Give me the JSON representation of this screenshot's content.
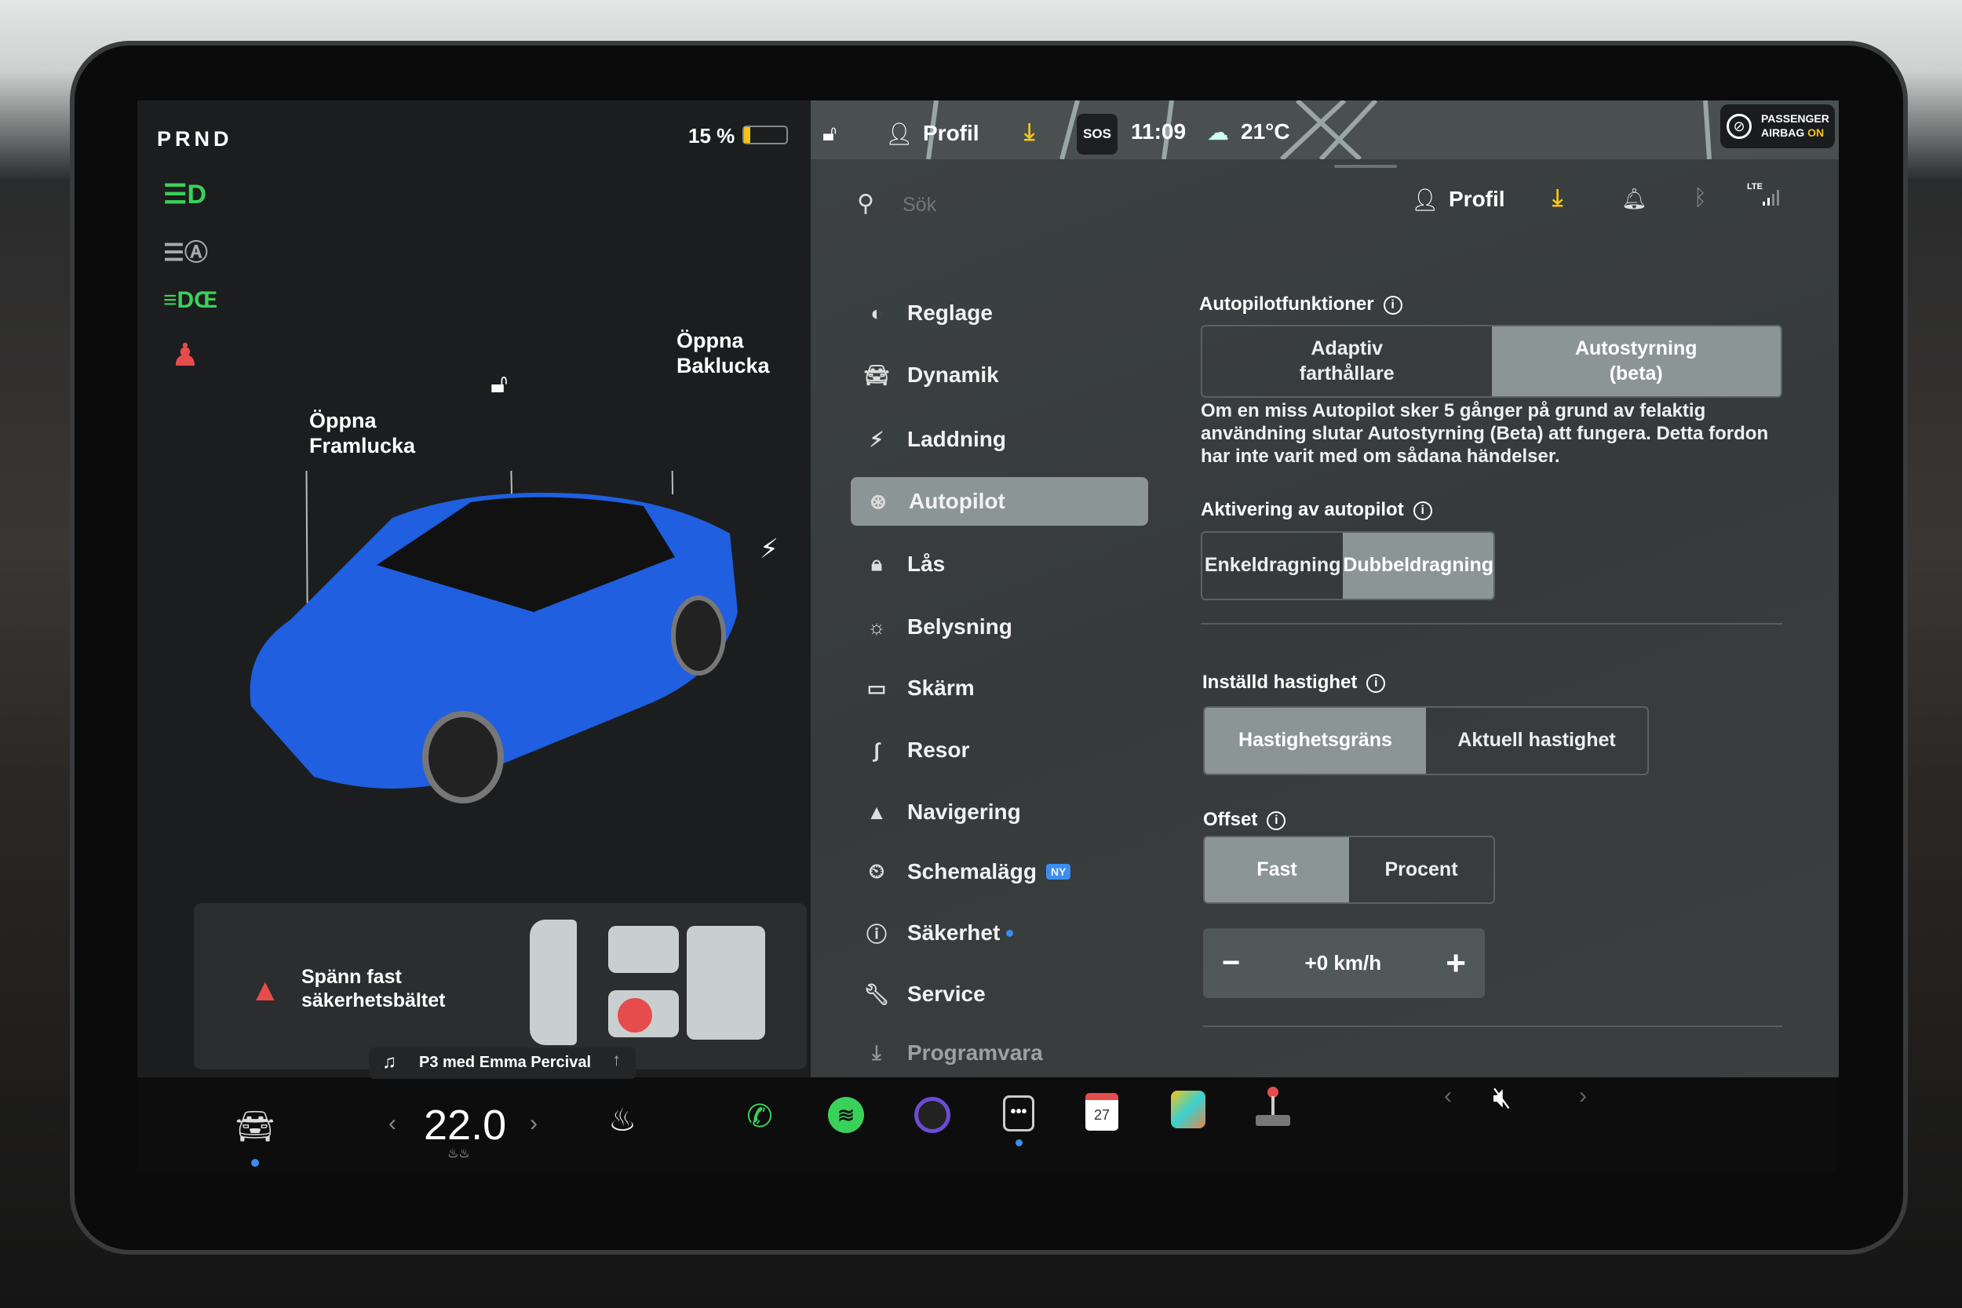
{
  "status_left": {
    "gear": "PRND",
    "battery": "15 %",
    "battery_level_percent": 15
  },
  "left_icons": [
    "low-beam-icon",
    "auto-high-beam-icon",
    "parking-lights-icon",
    "seatbelt-warning-icon"
  ],
  "car": {
    "frunk_label": "Öppna\nFramlucka",
    "trunk_label": "Öppna\nBaklucka",
    "color": "#1f5fe0"
  },
  "alert": {
    "text": "Spänn fast\nsäkerhetsbältet",
    "color": "#e74c4c"
  },
  "media": {
    "now_playing": "P3 med Emma Percival"
  },
  "top_bar": {
    "profile": "Profil",
    "sos": "SOS",
    "time": "11:09",
    "temp": "21°C",
    "airbag_line1": "PASSENGER",
    "airbag_line2": "AIRBAG",
    "airbag_state": "ON",
    "accent": "#f5c518"
  },
  "search": {
    "placeholder": "Sök",
    "profile": "Profil",
    "lte": "LTE"
  },
  "menu": [
    {
      "label": "Reglage",
      "icon": "toggle-icon"
    },
    {
      "label": "Dynamik",
      "icon": "car-icon"
    },
    {
      "label": "Laddning",
      "icon": "bolt-icon"
    },
    {
      "label": "Autopilot",
      "icon": "steering-wheel-icon",
      "active": true
    },
    {
      "label": "Lås",
      "icon": "lock-icon"
    },
    {
      "label": "Belysning",
      "icon": "sun-icon"
    },
    {
      "label": "Skärm",
      "icon": "display-icon"
    },
    {
      "label": "Resor",
      "icon": "trips-icon"
    },
    {
      "label": "Navigering",
      "icon": "navigation-icon"
    },
    {
      "label": "Schemalägg",
      "icon": "clock-icon",
      "badge": "NY"
    },
    {
      "label": "Säkerhet",
      "icon": "alert-circle-icon"
    },
    {
      "label": "Service",
      "icon": "wrench-icon"
    },
    {
      "label": "Programvara",
      "icon": "download-icon"
    }
  ],
  "autopilot": {
    "features_title": "Autopilotfunktioner",
    "features": [
      "Adaptiv\nfarthållare",
      "Autostyrning\n(beta)"
    ],
    "features_selected": 1,
    "notice": "Om en miss Autopilot sker 5 gånger på grund av felaktig användning slutar Autostyrning (Beta) att fungera. Detta fordon har inte varit med om sådana händelser.",
    "activation_title": "Aktivering av autopilot",
    "activation": [
      "Enkeldragning",
      "Dubbeldragning"
    ],
    "activation_selected": 1,
    "speed_title": "Inställd hastighet",
    "speed": [
      "Hastighetsgräns",
      "Aktuell hastighet"
    ],
    "speed_selected": 0,
    "offset_title": "Offset",
    "offset": [
      "Fast",
      "Procent"
    ],
    "offset_selected": 0,
    "offset_value": "+0 km/h",
    "minus": "−",
    "plus": "+"
  },
  "dock": {
    "temperature": "22.0",
    "items": [
      "car-icon",
      "seat-heater-icon",
      "phone-icon",
      "spotify-icon",
      "camera-icon",
      "more-icon",
      "calendar-icon",
      "photos-icon",
      "joystick-icon"
    ],
    "calendar_day": "27",
    "volume": "muted"
  }
}
